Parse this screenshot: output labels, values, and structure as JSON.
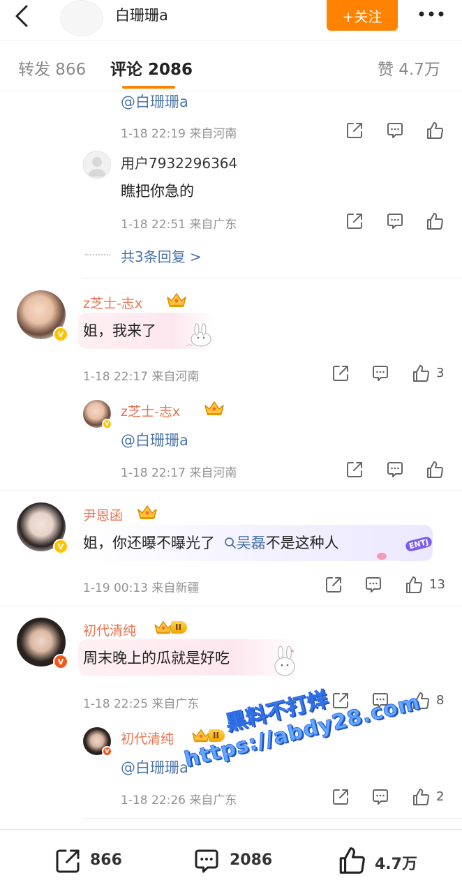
{
  "header": {
    "title": "白珊珊a",
    "follow_label": "+关注"
  },
  "tabs": {
    "repost": "转发 866",
    "comments": "评论 2086",
    "likes": "赞 4.7万"
  },
  "thread1": {
    "reply1": {
      "text": "@白珊珊a",
      "meta": "1-18 22:19  来自河南"
    },
    "reply2": {
      "name": "用户7932296364",
      "text": "瞧把你急的",
      "meta": "1-18 22:51  来自广东"
    },
    "more_replies": "共3条回复 >"
  },
  "comment1": {
    "name": "z芝士-志x",
    "text": "姐，我来了",
    "meta": "1-18 22:17  来自河南",
    "like_count": "3",
    "reply": {
      "name": "z芝士-志x",
      "text": "@白珊珊a",
      "meta": "1-18 22:17  来自河南"
    }
  },
  "comment2": {
    "name": "尹恩函",
    "text_before": "姐，你还曝不曝光了",
    "search_term": "吴磊",
    "text_after": "不是这种人",
    "badge_text": "ENTJ",
    "meta": "1-19 00:13  来自新疆",
    "like_count": "13"
  },
  "comment3": {
    "name": "初代清纯",
    "rank": "II",
    "text": "周末晚上的瓜就是好吃",
    "meta": "1-18 22:25  来自广东",
    "like_count": "8",
    "reply": {
      "name": "初代清纯",
      "rank": "II",
      "text": "@白珊珊a",
      "meta": "1-18 22:26  来自广东",
      "like_count": "2"
    }
  },
  "bottom": {
    "repost_count": "866",
    "comment_count": "2086",
    "like_count": "4.7万"
  },
  "watermark": {
    "line1": "黑料不打烊",
    "line2": "https://abdy28.com"
  },
  "colors": {
    "accent": "#ff8200",
    "username": "#eb7350",
    "mention": "#4b74a8",
    "meta": "#939393"
  },
  "icons": [
    "back-icon",
    "more-icon",
    "share-icon",
    "comment-icon",
    "like-icon",
    "search-icon",
    "crown-icon",
    "verified-icon"
  ]
}
